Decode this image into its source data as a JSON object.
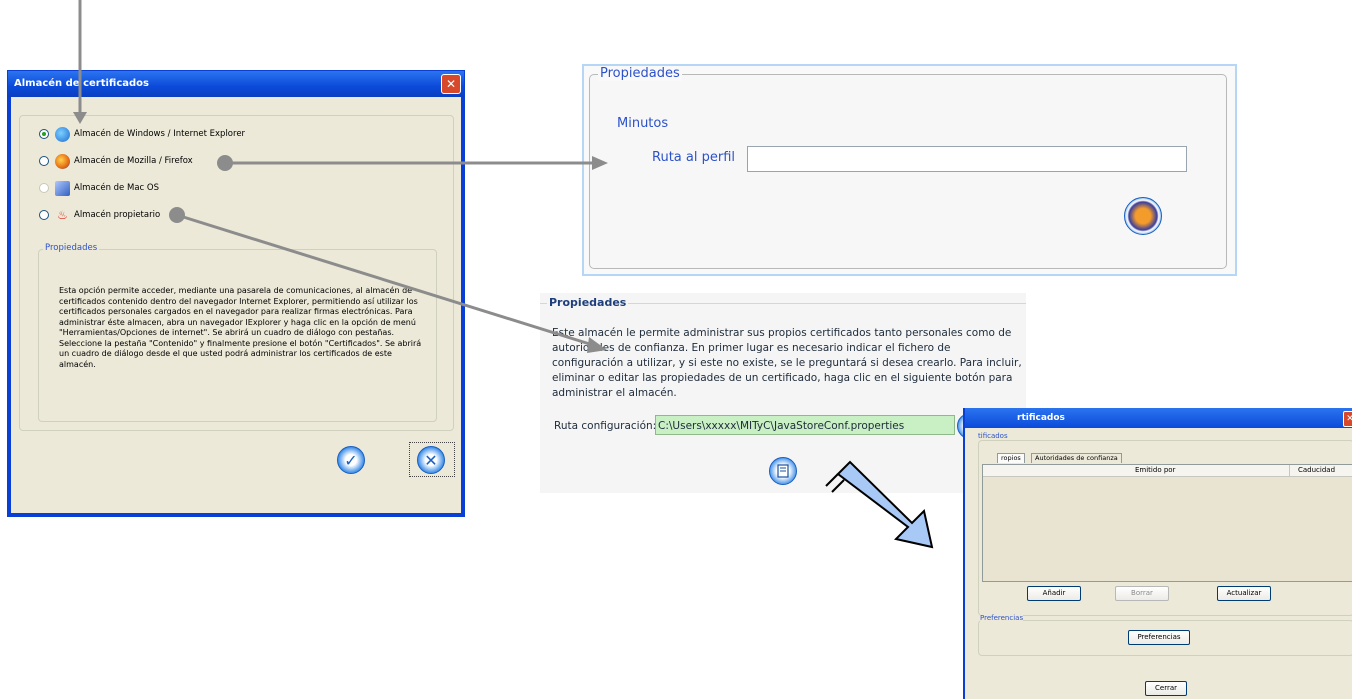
{
  "window_main": {
    "title": "Almacén de certificados",
    "close_symbol": "✕",
    "options": [
      {
        "label": "Almacén de Windows / Internet Explorer",
        "selected": true,
        "enabled": true,
        "icon": "internet-explorer-icon"
      },
      {
        "label": "Almacén de Mozilla / Firefox",
        "selected": false,
        "enabled": true,
        "icon": "firefox-icon"
      },
      {
        "label": "Almacén de Mac OS",
        "selected": false,
        "enabled": false,
        "icon": "mac-os-icon"
      },
      {
        "label": "Almacén propietario",
        "selected": false,
        "enabled": true,
        "icon": "java-icon"
      }
    ],
    "properties_legend": "Propiedades",
    "description": "Esta opción permite acceder, mediante una pasarela de comunicaciones, al almacén de certificados contenido dentro del navegador Internet Explorer, permitiendo así utilizar los certificados personales cargados en el navegador para realizar firmas electrónicas. Para administrar éste almacen, abra un navegador IExplorer y haga clic en la opción de menú \"Herramientas/Opciones de internet\". Se abrirá un cuadro de diálogo con pestañas. Seleccione la pestaña \"Contenido\" y finalmente presione el botón \"Certificados\". Se abrirá un cuadro de diálogo desde el que usted podrá administrar los certificados de este almacén.",
    "ok_icon": "checkmark-icon",
    "cancel_icon": "cancel-x-icon"
  },
  "panel_firefox": {
    "legend": "Propiedades",
    "minutos_label": "Minutos",
    "profile_label": "Ruta al perfil",
    "profile_value": "",
    "browse_icon": "firefox-icon"
  },
  "panel_proprietary": {
    "legend": "Propiedades",
    "description": "Este almacén le permite administrar sus propios certificados tanto personales como de autoridades de confianza. En primer lugar es necesario indicar el fichero de configuración a utilizar, y si este no existe, se le preguntará si desea crearlo. Para incluir, eliminar o editar las propiedades de un certificado, haga clic en el siguiente botón para administrar el almacén.",
    "config_label": "Ruta configuración:",
    "config_value": "C:\\Users\\xxxxx\\MITyC\\JavaStoreConf.properties",
    "browse_icon": "folder-icon",
    "manage_icon": "manage-store-icon"
  },
  "window_certs": {
    "title": "rtificados",
    "group_legend": "tificados",
    "tabs": [
      "ropios",
      "Autoridades de confianza"
    ],
    "columns": [
      "Emitido por",
      "Caducidad"
    ],
    "buttons": {
      "add": "Añadir",
      "delete": "Borrar",
      "refresh": "Actualizar"
    },
    "prefs_legend": "Preferencias",
    "prefs_button": "Preferencias",
    "close_button": "Cerrar",
    "close_symbol": "✕"
  },
  "colors": {
    "titlebar": "#0b4ad9",
    "accent_blue": "#2c52c9",
    "connector_gray": "#8c8c8c",
    "path_field_bg": "#c9efc4",
    "big_arrow": "#a8c8f5"
  }
}
